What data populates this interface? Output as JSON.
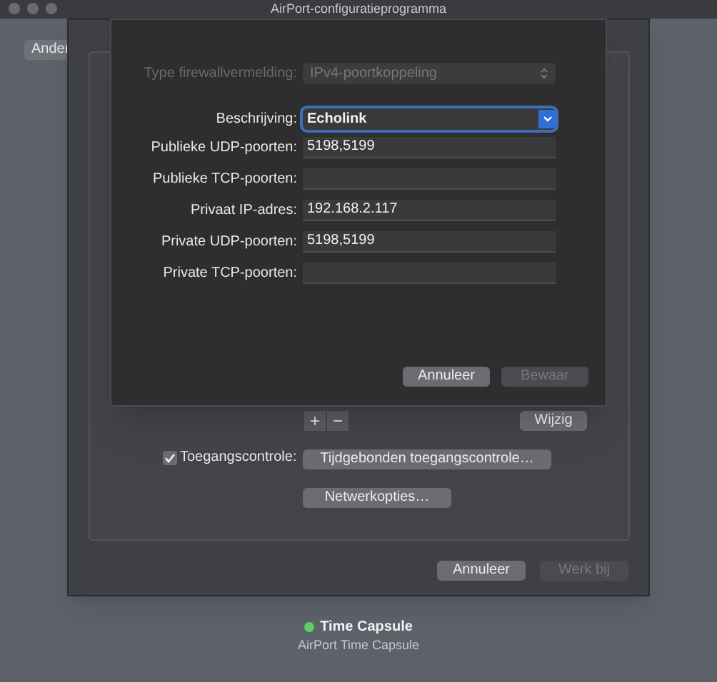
{
  "window": {
    "title": "AirPort-configuratieprogramma"
  },
  "background_button": {
    "label": "Ander"
  },
  "dialog": {
    "type_field": {
      "label": "Type firewallvermelding:",
      "value": "IPv4-poortkoppeling",
      "disabled": true
    },
    "fields": [
      {
        "kind": "combo",
        "label": "Beschrijving:",
        "value": "Echolink",
        "focused": true
      },
      {
        "kind": "text",
        "label": "Publieke UDP-poorten:",
        "value": "5198,5199",
        "focused": false
      },
      {
        "kind": "text",
        "label": "Publieke TCP-poorten:",
        "focused": false
      },
      {
        "kind": "text",
        "label": "Privaat IP-adres:",
        "value": "192.168.2.117",
        "focused": false
      },
      {
        "kind": "text",
        "label": "Private UDP-poorten:",
        "value": "5198,5199",
        "focused": false
      },
      {
        "kind": "text",
        "label": "Private TCP-poorten:",
        "focused": false
      }
    ],
    "buttons": [
      {
        "label": "Annuleer",
        "disabled": false
      },
      {
        "label": "Bewaar",
        "disabled": true
      }
    ]
  },
  "sheet": {
    "add_remove": [
      "+",
      "−"
    ],
    "edit_button": "Wijzig",
    "access_control": {
      "label": "Toegangscontrole:",
      "checked": true
    },
    "timed_button": "Tijdgebonden toegangscontrole…",
    "network_button": "Netwerkopties…",
    "buttons": [
      {
        "label": "Annuleer",
        "disabled": false
      },
      {
        "label": "Werk bij",
        "disabled": true
      }
    ]
  },
  "device": {
    "name": "Time Capsule",
    "online": true,
    "model": "AirPort Time Capsule"
  }
}
